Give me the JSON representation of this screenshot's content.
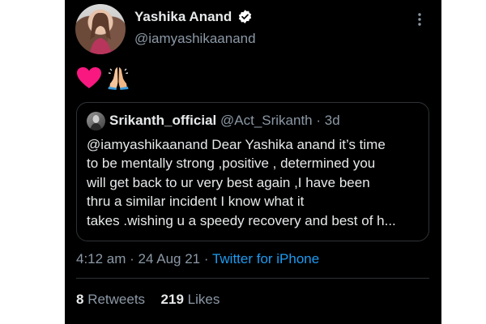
{
  "author": {
    "name": "Yashika Anand",
    "handle": "@iamyashikaanand"
  },
  "tweet": {
    "emojis": [
      "heart-emoji",
      "folded-hands-emoji"
    ]
  },
  "quoted_tweet": {
    "name": "Srikanth_official",
    "handle": "@Act_Srikanth",
    "separator": " · ",
    "age": "3d",
    "text_lines": [
      "@iamyashikaanand Dear Yashika anand it’s time",
      "to be mentally strong ,positive , determined you",
      "will get back to ur very best again ,I have been",
      "thru a similar incident I know what it",
      "takes .wishing u a speedy recovery and best of h..."
    ]
  },
  "meta": {
    "time": "4:12 am",
    "separator": " · ",
    "date": "24 Aug 21",
    "separator2": " · ",
    "source": "Twitter for iPhone"
  },
  "stats": {
    "retweets_count": "8",
    "retweets_label": " Retweets",
    "likes_count": "219",
    "likes_label": " Likes"
  },
  "colors": {
    "background": "#000000",
    "text": "#e7e9ea",
    "muted": "#8b98a5",
    "accent": "#1d9bf0",
    "border": "#2f3336",
    "heart": "#f91880"
  },
  "icons": {
    "verified": "verified-badge-icon",
    "more": "more-options-icon"
  }
}
